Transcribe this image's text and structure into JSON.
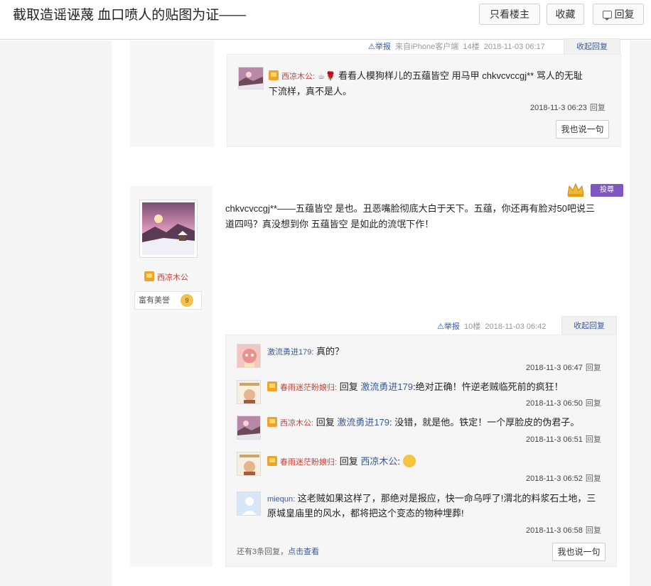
{
  "page": {
    "title": "截取造谣诬蔑 血口喷人的贴图为证——",
    "buttons": {
      "only_op": "只看楼主",
      "favorite": "收藏",
      "reply": "回复"
    }
  },
  "floor14": {
    "meta": {
      "report": "举报",
      "source": "来自iPhone客户端",
      "floor": "14楼",
      "time": "2018-11-03 06:17",
      "collapse": "收起回复"
    },
    "reply": {
      "user": "西凉木公",
      "sep": ":",
      "text_line1": "看看人模狗样儿的五蕴皆空 用马甲 chkvcvccgj** 骂人的无耻",
      "text_line2": "下流样，真不是人。",
      "time": "2018-11-3 06:23",
      "reply_label": "回复"
    },
    "say_button": "我也说一句"
  },
  "floor10": {
    "author": {
      "name": "西凉木公",
      "level_title": "富有美誉",
      "level_num": "9"
    },
    "tag": "投尊",
    "body": "chkvcvccgj**——五蕴皆空 是也。丑恶嘴脸彻底大白于天下。五蕴，你还再有脸对50吧说三道四吗？真没想到你 五蕴皆空 是如此的流氓下作！",
    "body_line1": "chkvcvccgj**——五蕴皆空 是也。丑恶嘴脸彻底大白于天下。五蕴，你还再有脸对50吧说三",
    "body_line2": "道四吗？真没想到你 五蕴皆空 是如此的流氓下作！",
    "meta": {
      "report": "举报",
      "floor": "10楼",
      "time": "2018-11-03 06:42",
      "collapse": "收起回复"
    },
    "replies": [
      {
        "user": "激流勇进179",
        "sep": ":",
        "text": "真的？",
        "time": "2018-11-3 06:47",
        "reply_label": "回复"
      },
      {
        "user": "春雨迷茫盼娘归",
        "sep": ":",
        "pre": "回复",
        "target": "激流勇进179",
        "text": ":绝对正确！忤逆老贼临死前的疯狂！",
        "time": "2018-11-3 06:50",
        "reply_label": "回复"
      },
      {
        "user": "西凉木公",
        "sep": ":",
        "pre": "回复",
        "target": "激流勇进179",
        "text": ": 没错，就是他。铁定！一个厚脸皮的伪君子。",
        "time": "2018-11-3 06:51",
        "reply_label": "回复"
      },
      {
        "user": "春雨迷茫盼娘归",
        "sep": ":",
        "pre": "回复",
        "target": "西凉木公",
        "text": ":",
        "time": "2018-11-3 06:52",
        "reply_label": "回复"
      },
      {
        "user": "miequn",
        "sep": ":",
        "text_line1": "这老贼如果这样了，那绝对是报应，快一命乌呼了!渭北的料浆石土地，三",
        "text_line2": "原城皇庙里的风水，都将把这个变态的物种埋葬!",
        "time": "2018-11-3 06:58",
        "reply_label": "回复"
      }
    ],
    "more": {
      "prefix": "还有3条回复，",
      "link": "点击查看"
    },
    "say_button": "我也说一句"
  },
  "colors": {
    "link": "#3b5998",
    "username_red": "#c0453a",
    "tag_purple": "#7e57c2"
  }
}
